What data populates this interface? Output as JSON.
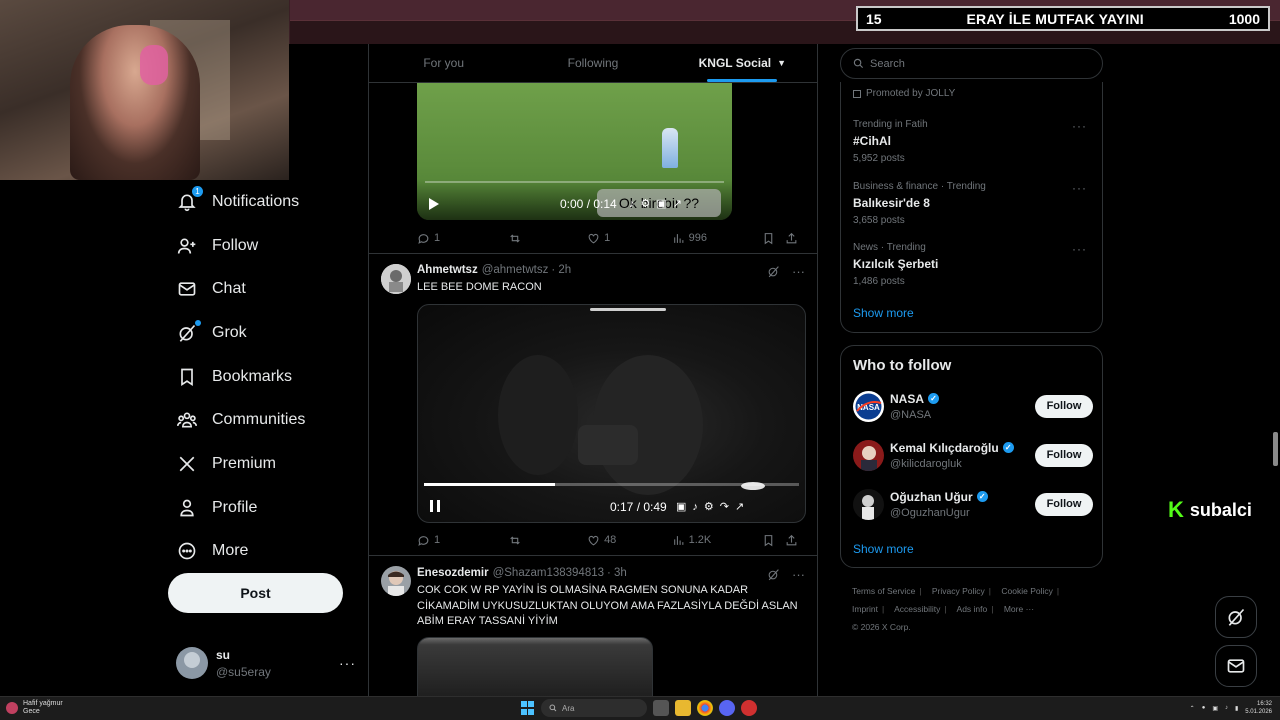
{
  "stream_banner": {
    "left": "15",
    "title": "ERAY İLE MUTFAK YAYINI",
    "right": "1000"
  },
  "nav": {
    "items": [
      {
        "label": "Notifications",
        "icon": "bell-icon",
        "badge": "1"
      },
      {
        "label": "Follow",
        "icon": "person-plus-icon"
      },
      {
        "label": "Chat",
        "icon": "envelope-icon"
      },
      {
        "label": "Grok",
        "icon": "grok-icon"
      },
      {
        "label": "Bookmarks",
        "icon": "bookmark-icon"
      },
      {
        "label": "Communities",
        "icon": "people-icon"
      },
      {
        "label": "Premium",
        "icon": "x-logo-icon"
      },
      {
        "label": "Profile",
        "icon": "person-icon"
      },
      {
        "label": "More",
        "icon": "more-circle-icon"
      }
    ],
    "post_label": "Post"
  },
  "account": {
    "display_name": "su",
    "handle": "@su5eray",
    "more": "···"
  },
  "tabs": [
    {
      "label": "For you"
    },
    {
      "label": "Following"
    },
    {
      "label": "KNGL Social",
      "active": true
    }
  ],
  "tweet1": {
    "video_time": "0:00 / 0:14",
    "caption": "Ok birebir ??",
    "replies": "1",
    "likes": "1",
    "views": "996"
  },
  "tweet2": {
    "name": "Ahmetwtsz",
    "handle": "@ahmetwtsz",
    "time": "· 2h",
    "text": "LEE BEE DOME RACON",
    "video_time": "0:17 / 0:49",
    "video_progress": 0.35,
    "replies": "1",
    "likes": "48",
    "views": "1.2K"
  },
  "tweet3": {
    "name": "Enesozdemir",
    "handle": "@Shazam138394813",
    "time": "· 3h",
    "text": "COK COK W RP YAYİN İS OLMASİNA RAGMEN SONUNA KADAR CİKAMADİM UYKUSUZLUKTAN OLUYOM AMA FAZLASİYLA DEĞDİ ASLAN ABİM ERAY TASSANİ YİYİM"
  },
  "search": {
    "placeholder": "Search"
  },
  "trends": {
    "promoted": "Promoted by JOLLY",
    "items": [
      {
        "category": "Trending in Fatih",
        "title": "#CihAl",
        "count": "5,952 posts"
      },
      {
        "category": "Business & finance · Trending",
        "title": "Balıkesir'de 8",
        "count": "3,658 posts"
      },
      {
        "category": "News · Trending",
        "title": "Kızılcık Şerbeti",
        "count": "1,486 posts"
      }
    ],
    "show_more": "Show more"
  },
  "who_to_follow": {
    "title": "Who to follow",
    "accounts": [
      {
        "name": "NASA",
        "handle": "@NASA",
        "button": "Follow"
      },
      {
        "name": "Kemal Kılıçdaroğlu",
        "handle": "@kilicdarogluk",
        "button": "Follow"
      },
      {
        "name": "Oğuzhan Uğur",
        "handle": "@OguzhanUgur",
        "button": "Follow"
      }
    ],
    "show_more": "Show more"
  },
  "footer": {
    "links": [
      "Terms of Service",
      "Privacy Policy",
      "Cookie Policy",
      "Imprint",
      "Accessibility",
      "Ads info",
      "More ···"
    ],
    "copyright": "© 2026 X Corp."
  },
  "kick_overlay": {
    "name": "subalci"
  },
  "taskbar": {
    "weather_line1": "Hafif yağmur",
    "weather_line2": "Gece",
    "search_placeholder": "Ara",
    "time": "16:32",
    "date": "5.01.2026"
  }
}
